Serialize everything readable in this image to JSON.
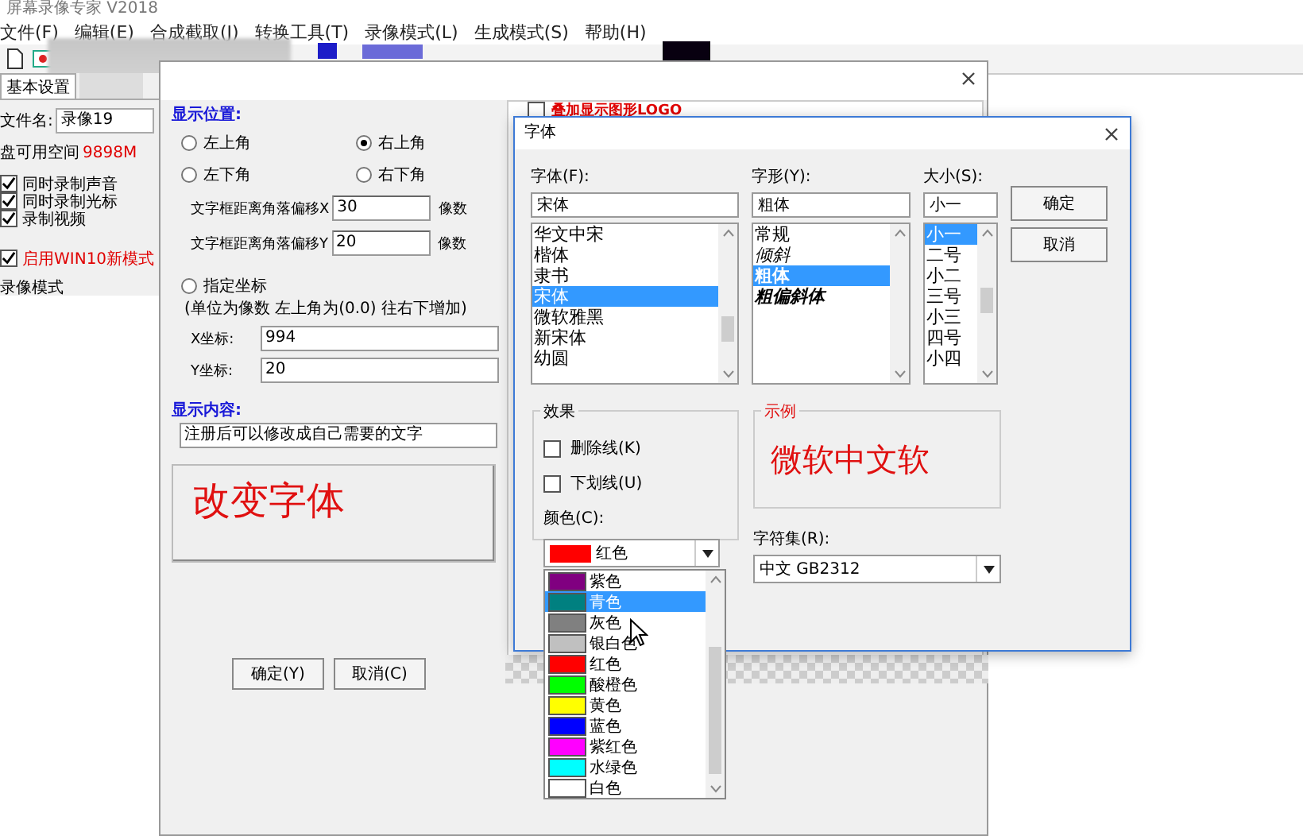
{
  "app": {
    "title": "屏幕录像专家 V2018",
    "menu": [
      "文件(F)",
      "编辑(E)",
      "合成截取(J)",
      "转换工具(T)",
      "录像模式(L)",
      "生成模式(S)",
      "帮助(H)"
    ],
    "tabs": [
      {
        "label": "基本设置",
        "selected": true
      }
    ],
    "file_name_label": "文件名:",
    "file_name": "录像19",
    "disk_label": "盘可用空间",
    "disk_free": "9898M",
    "options": [
      {
        "label": "同时录制声音",
        "checked": true
      },
      {
        "label": "同时录制光标",
        "checked": true
      },
      {
        "label": "录制视频",
        "checked": true
      }
    ],
    "win10": {
      "label": "启用WIN10新模式",
      "checked": true
    },
    "section": "录像模式"
  },
  "text_dialog": {
    "logo": {
      "label": "叠加显示图形LOGO",
      "checked": false
    },
    "position_heading": "显示位置:",
    "positions": [
      {
        "label": "左上角",
        "selected": false
      },
      {
        "label": "右上角",
        "selected": true
      },
      {
        "label": "左下角",
        "selected": false
      },
      {
        "label": "右下角",
        "selected": false
      }
    ],
    "offsets": [
      {
        "label": "文字框距离角落偏移X",
        "value": "30",
        "unit": "像数"
      },
      {
        "label": "文字框距离角落偏移Y",
        "value": "20",
        "unit": "像数"
      }
    ],
    "custom": {
      "label": "指定坐标",
      "selected": false,
      "note": "(单位为像数 左上角为(0.0) 往右下增加)"
    },
    "coords": [
      {
        "label": "X坐标:",
        "value": "994"
      },
      {
        "label": "Y坐标:",
        "value": "20"
      }
    ],
    "content_heading": "显示内容:",
    "content": "注册后可以修改成自己需要的文字",
    "preview": "改变字体",
    "buttons": [
      "确定(Y)",
      "取消(C)"
    ]
  },
  "font_dialog": {
    "title": "字体",
    "font_label": "字体(F):",
    "font_value": "宋体",
    "fonts": [
      {
        "label": "华文中宋",
        "selected": false
      },
      {
        "label": "楷体",
        "selected": false
      },
      {
        "label": "隶书",
        "selected": false
      },
      {
        "label": "宋体",
        "selected": true
      },
      {
        "label": "微软雅黑",
        "selected": false
      },
      {
        "label": "新宋体",
        "selected": false
      },
      {
        "label": "幼圆",
        "selected": false
      }
    ],
    "style_label": "字形(Y):",
    "style_value": "粗体",
    "styles": [
      {
        "label": "常规",
        "kind": "regular",
        "selected": false
      },
      {
        "label": "倾斜",
        "kind": "italic",
        "selected": false
      },
      {
        "label": "粗体",
        "kind": "bold",
        "selected": true
      },
      {
        "label": "粗偏斜体",
        "kind": "bold-italic",
        "selected": false
      }
    ],
    "size_label": "大小(S):",
    "size_value": "小一",
    "sizes": [
      {
        "label": "小一",
        "selected": true
      },
      {
        "label": "二号",
        "selected": false
      },
      {
        "label": "小二",
        "selected": false
      },
      {
        "label": "三号",
        "selected": false
      },
      {
        "label": "小三",
        "selected": false
      },
      {
        "label": "四号",
        "selected": false
      },
      {
        "label": "小四",
        "selected": false
      }
    ],
    "buttons": [
      "确定",
      "取消"
    ],
    "effects_label": "效果",
    "effects": [
      {
        "label": "删除线(K)",
        "checked": false
      },
      {
        "label": "下划线(U)",
        "checked": false
      }
    ],
    "color_label": "颜色(C):",
    "color": {
      "label": "红色",
      "color": "#ff0000"
    },
    "sample_label": "示例",
    "sample": "微软中文软",
    "charset_label": "字符集(R):",
    "charset": "中文 GB2312"
  },
  "color_list": [
    {
      "label": "紫色",
      "color": "#800080",
      "selected": false
    },
    {
      "label": "青色",
      "color": "#008080",
      "selected": true
    },
    {
      "label": "灰色",
      "color": "#808080",
      "selected": false
    },
    {
      "label": "银白色",
      "color": "#c0c0c0",
      "selected": false
    },
    {
      "label": "红色",
      "color": "#ff0000",
      "selected": false
    },
    {
      "label": "酸橙色",
      "color": "#00ff00",
      "selected": false
    },
    {
      "label": "黄色",
      "color": "#ffff00",
      "selected": false
    },
    {
      "label": "蓝色",
      "color": "#0000ff",
      "selected": false
    },
    {
      "label": "紫红色",
      "color": "#ff00ff",
      "selected": false
    },
    {
      "label": "水绿色",
      "color": "#00ffff",
      "selected": false
    },
    {
      "label": "白色",
      "color": "#ffffff",
      "selected": false
    }
  ]
}
